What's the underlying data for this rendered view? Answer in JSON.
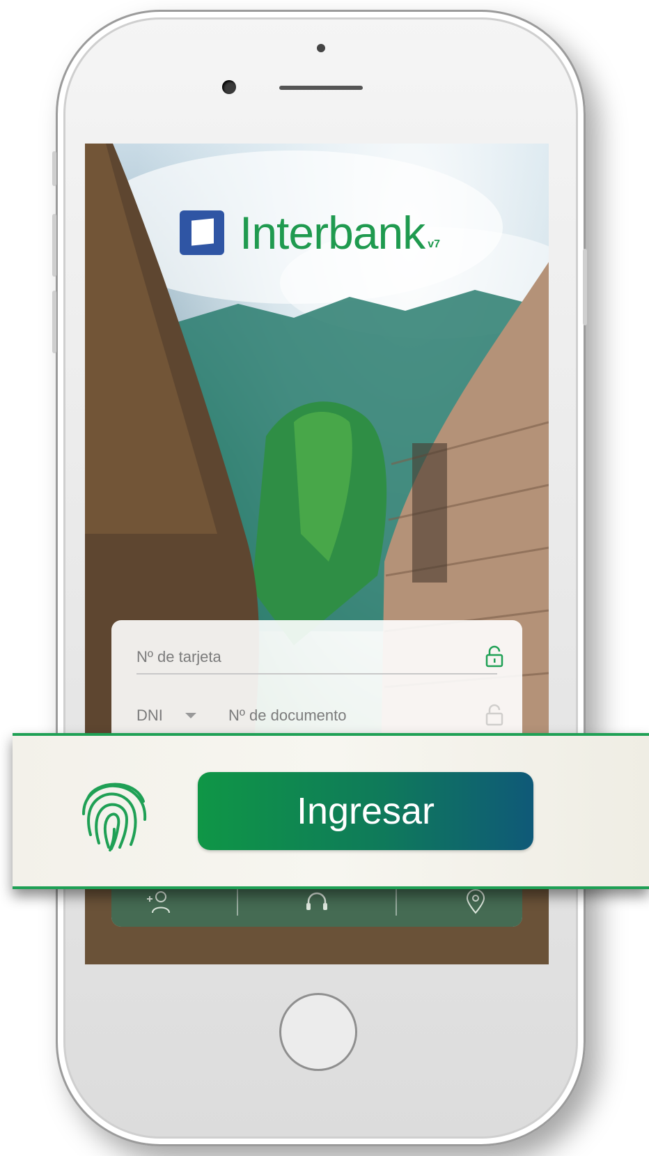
{
  "app": {
    "brand": "Interbank",
    "version": "v7"
  },
  "login": {
    "card_number_placeholder": "Nº de tarjeta",
    "document_type": "DNI",
    "document_number_placeholder": "Nº de documento"
  },
  "actions": {
    "submit_label": "Ingresar"
  },
  "bottom_bar": {
    "icons": [
      "add-user-icon",
      "headset-icon",
      "location-pin-icon"
    ]
  },
  "colors": {
    "brand_green": "#1f9a4f",
    "brand_blue": "#2f55a4",
    "button_gradient_start": "#0f9646",
    "button_gradient_end": "#0f5978"
  }
}
